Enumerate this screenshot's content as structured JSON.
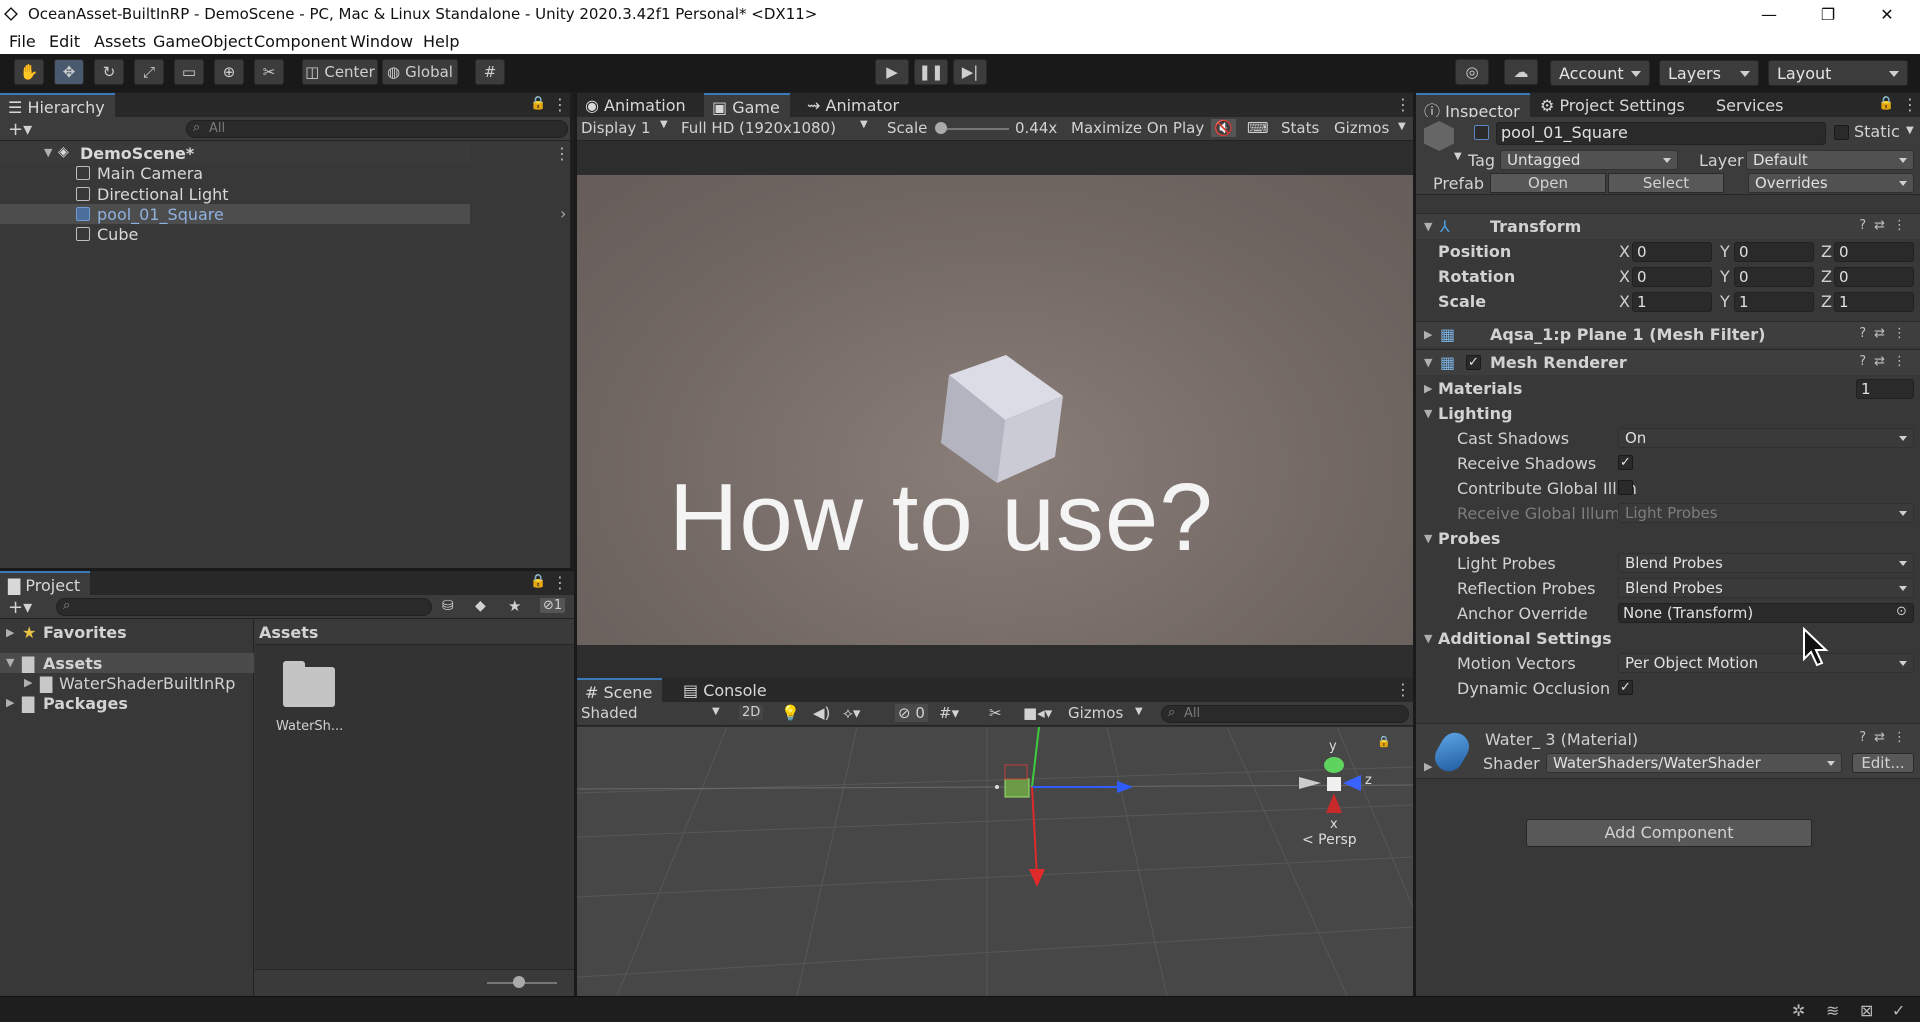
{
  "window": {
    "title": "OceanAsset-BuiltInRP - DemoScene - PC, Mac & Linux Standalone - Unity 2020.3.42f1 Personal* <DX11>",
    "minimize": "—",
    "restore": "❐",
    "close": "✕"
  },
  "menu": [
    "File",
    "Edit",
    "Assets",
    "GameObject",
    "Component",
    "Window",
    "Help"
  ],
  "toolbar": {
    "center": "Center",
    "global": "Global",
    "account": "Account",
    "layers": "Layers",
    "layout": "Layout"
  },
  "hierarchy": {
    "tab": "Hierarchy",
    "search_placeholder": "All",
    "scene": "DemoScene*",
    "items": [
      "Main Camera",
      "Directional Light",
      "pool_01_Square",
      "Cube"
    ]
  },
  "project": {
    "tab": "Project",
    "favorites": "Favorites",
    "assets": "Assets",
    "water_folder": "WaterShaderBuiltInRp",
    "packages": "Packages",
    "breadcrumb": "Assets",
    "grid_item": "WaterSh...",
    "hidden_count": "1"
  },
  "game": {
    "tabs": [
      "Animation",
      "Game",
      "Animator"
    ],
    "display": "Display 1",
    "resolution": "Full HD (1920x1080)",
    "scale_label": "Scale",
    "scale_value": "0.44x",
    "maximize": "Maximize On Play",
    "stats": "Stats",
    "gizmos": "Gizmos",
    "overlay_text": "How to use?"
  },
  "scene": {
    "tabs": [
      "Scene",
      "Console"
    ],
    "shading": "Shaded",
    "mode_2d": "2D",
    "hidden_count": "0",
    "gizmos": "Gizmos",
    "search_placeholder": "All",
    "axis_y": "y",
    "axis_z": "z",
    "axis_x": "x",
    "persp": "< Persp"
  },
  "inspector": {
    "tabs": [
      "Inspector",
      "Project Settings",
      "Services"
    ],
    "object_name": "pool_01_Square",
    "static_label": "Static",
    "tag_label": "Tag",
    "tag_value": "Untagged",
    "layer_label": "Layer",
    "layer_value": "Default",
    "prefab_label": "Prefab",
    "prefab_open": "Open",
    "prefab_select": "Select",
    "prefab_overrides": "Overrides",
    "transform": {
      "title": "Transform",
      "rows": [
        {
          "label": "Position",
          "x": "0",
          "y": "0",
          "z": "0"
        },
        {
          "label": "Rotation",
          "x": "0",
          "y": "0",
          "z": "0"
        },
        {
          "label": "Scale",
          "x": "1",
          "y": "1",
          "z": "1"
        }
      ],
      "axis_x": "X",
      "axis_y": "Y",
      "axis_z": "Z"
    },
    "mesh_filter": "Aqsa_1:p Plane 1 (Mesh Filter)",
    "mesh_renderer": {
      "title": "Mesh Renderer",
      "materials": "Materials",
      "materials_count": "1",
      "lighting": "Lighting",
      "cast_shadows_label": "Cast Shadows",
      "cast_shadows_value": "On",
      "receive_shadows": "Receive Shadows",
      "contribute_gi": "Contribute Global Illun",
      "receive_gi": "Receive Global Illumir",
      "receive_gi_value": "Light Probes",
      "probes": "Probes",
      "light_probes_label": "Light Probes",
      "light_probes_value": "Blend Probes",
      "reflection_probes_label": "Reflection Probes",
      "reflection_probes_value": "Blend Probes",
      "anchor_label": "Anchor Override",
      "anchor_value": "None (Transform)",
      "additional": "Additional Settings",
      "motion_label": "Motion Vectors",
      "motion_value": "Per Object Motion",
      "dynamic_occlusion": "Dynamic Occlusion"
    },
    "material": {
      "title": "Water_ 3 (Material)",
      "shader_label": "Shader",
      "shader_value": "WaterShaders/WaterShader",
      "edit": "Edit..."
    },
    "add_component": "Add Component"
  },
  "colors": {
    "accent": "#3a79bb",
    "selection": "#3e5f8a",
    "game_bg": "#6e6460"
  }
}
